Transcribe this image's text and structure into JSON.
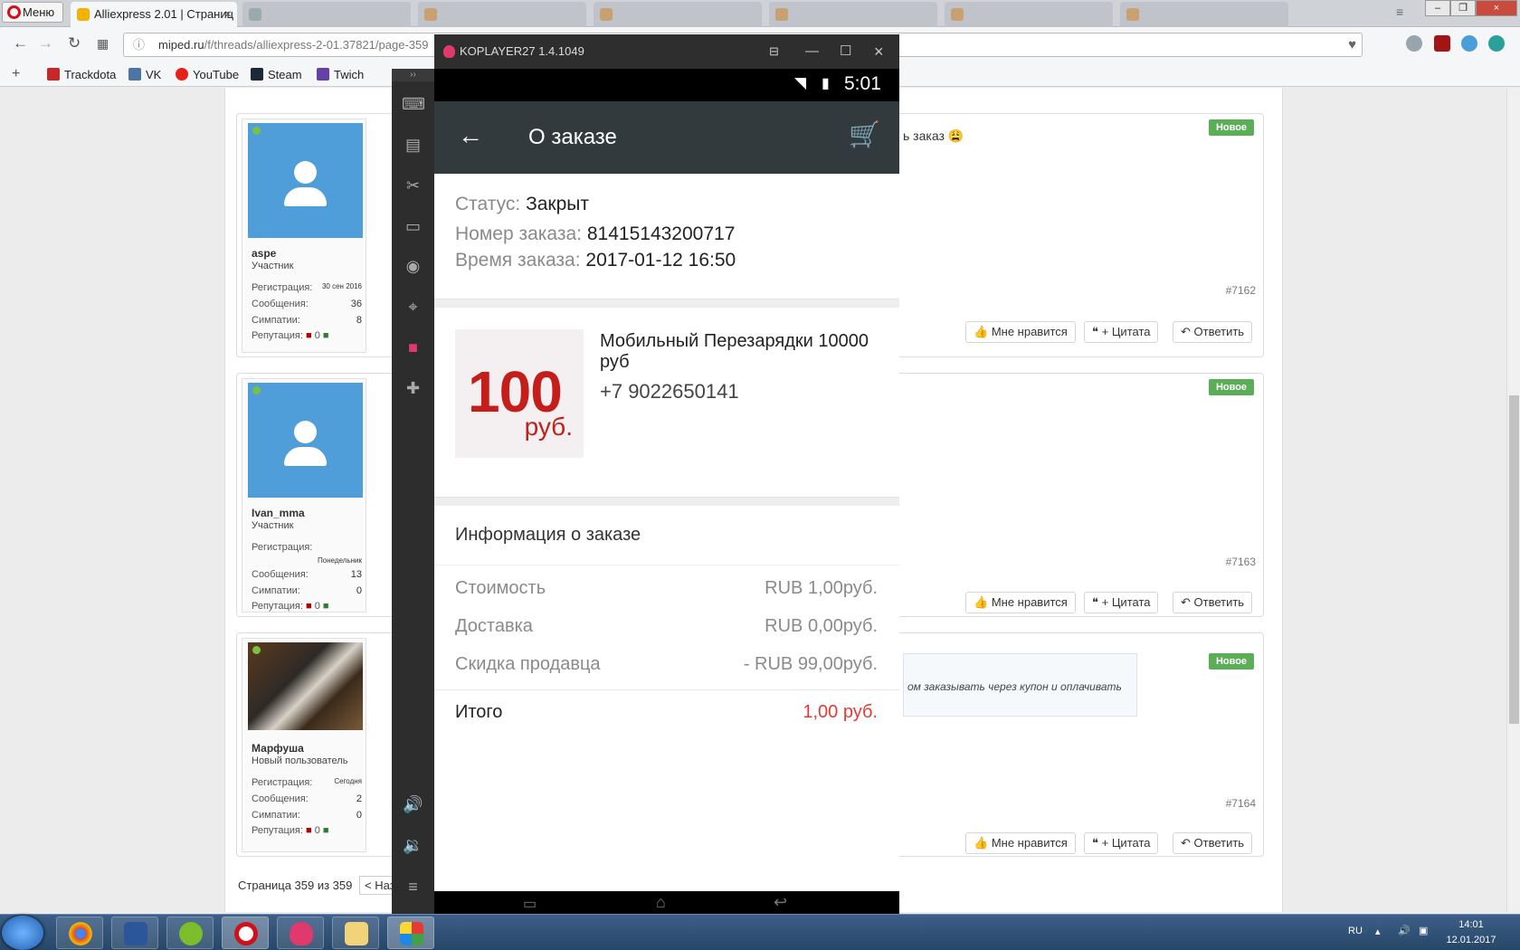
{
  "browser": {
    "menu_label": "Меню",
    "tabs": [
      {
        "label": "Alliexpress 2.01 | Страниц",
        "active": true
      },
      {
        "label": "",
        "active": false
      },
      {
        "label": "",
        "active": false
      },
      {
        "label": "",
        "active": false
      },
      {
        "label": "",
        "active": false
      },
      {
        "label": "",
        "active": false
      }
    ],
    "url_domain": "miped.ru",
    "url_path": "/f/threads/alliexpress-2-01.37821/page-359",
    "bookmarks": [
      "Trackdota",
      "VK",
      "YouTube",
      "Steam",
      "Twich"
    ]
  },
  "forum": {
    "posts": [
      {
        "username": "aspe",
        "role": "Участник",
        "registration_label": "Регистрация:",
        "registration_value": "30 сен 2016",
        "messages_label": "Сообщения:",
        "messages_value": "36",
        "likes_label": "Симпатии:",
        "likes_value": "8",
        "reputation_label": "Репутация:",
        "reputation_value": "0",
        "text": "ь заказ 😩",
        "badge": "Новое",
        "number": "#7162"
      },
      {
        "username": "Ivan_mma",
        "role": "Участник",
        "registration_label": "Регистрация:",
        "registration_value": "Понедельник",
        "messages_label": "Сообщения:",
        "messages_value": "13",
        "likes_label": "Симпатии:",
        "likes_value": "0",
        "reputation_label": "Репутация:",
        "reputation_value": "0",
        "text": "",
        "badge": "Новое",
        "number": "#7163"
      },
      {
        "username": "Марфуша",
        "role": "Новый пользователь",
        "registration_label": "Регистрация:",
        "registration_value": "Сегодня",
        "messages_label": "Сообщения:",
        "messages_value": "2",
        "likes_label": "Симпатии:",
        "likes_value": "0",
        "reputation_label": "Репутация:",
        "reputation_value": "0",
        "text": "ом заказывать через купон и оплачивать",
        "badge": "Новое",
        "number": "#7164"
      }
    ],
    "like_label": "Мне нравится",
    "quote_label": "+ Цитата",
    "reply_label": "Ответить",
    "pager_text": "Страница 359 из 359",
    "pager_prev": "< Наз"
  },
  "koplayer": {
    "title": "KOPLAYER27 1.4.1049",
    "clock": "5:01",
    "app_title": "О заказе",
    "status_label": "Статус:",
    "status_value": "Закрыт",
    "order_no_label": "Номер заказа:",
    "order_no_value": "81415143200717",
    "order_time_label": "Время заказа:",
    "order_time_value": "2017-01-12 16:50",
    "product_amount": "100",
    "product_currency": "руб.",
    "product_name": "Мобильный Перезарядки 10000 руб",
    "product_phone": "+7 9022650141",
    "info_heading": "Информация о заказе",
    "cost_label": "Стоимость",
    "cost_value": "RUB 1,00руб.",
    "delivery_label": "Доставка",
    "delivery_value": "RUB 0,00руб.",
    "discount_label": "Скидка продавца",
    "discount_value": "- RUB 99,00руб.",
    "total_label": "Итого",
    "total_value": "1,00 руб.",
    "accent_color": "#c51d1a",
    "total_color": "#e53935"
  },
  "taskbar": {
    "lang": "RU",
    "time": "14:01",
    "date": "12.01.2017"
  }
}
